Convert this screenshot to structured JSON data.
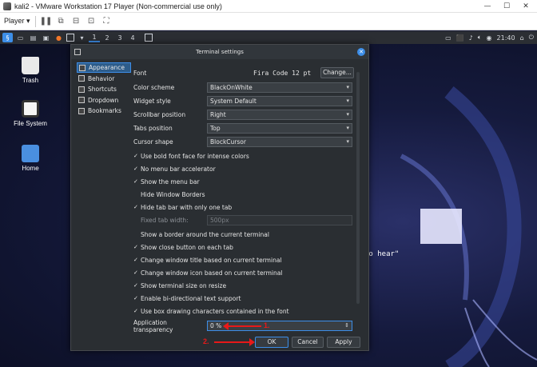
{
  "vmware": {
    "title": "kali2 - VMware Workstation 17 Player (Non-commercial use only)",
    "player_menu": "Player ▾"
  },
  "guest_panel": {
    "workspaces": [
      "1",
      "2",
      "3",
      "4"
    ],
    "clock": "21:40"
  },
  "desktop": {
    "icons": [
      {
        "label": "Trash"
      },
      {
        "label": "File System"
      },
      {
        "label": "Home"
      }
    ],
    "wallpaper_text": "to hear\""
  },
  "dialog": {
    "title": "Terminal settings",
    "sidebar": [
      {
        "label": "Appearance",
        "active": true
      },
      {
        "label": "Behavior"
      },
      {
        "label": "Shortcuts"
      },
      {
        "label": "Dropdown"
      },
      {
        "label": "Bookmarks"
      }
    ],
    "font": {
      "label": "Font",
      "value": "Fira Code 12 pt",
      "button": "Change..."
    },
    "combos": [
      {
        "label": "Color scheme",
        "value": "BlackOnWhite"
      },
      {
        "label": "Widget style",
        "value": "System Default"
      },
      {
        "label": "Scrollbar position",
        "value": "Right"
      },
      {
        "label": "Tabs position",
        "value": "Top"
      },
      {
        "label": "Cursor shape",
        "value": "BlockCursor"
      }
    ],
    "checks_a": [
      {
        "label": "Use bold font face for intense colors",
        "checked": true
      },
      {
        "label": "No menu bar accelerator",
        "checked": true
      },
      {
        "label": "Show the menu bar",
        "checked": true
      },
      {
        "label": "Hide Window Borders",
        "checked": false
      },
      {
        "label": "Hide tab bar with only one tab",
        "checked": true
      }
    ],
    "fixed_tab": {
      "label": "Fixed tab width:",
      "value": "500px"
    },
    "checks_b": [
      {
        "label": "Show a border around the current terminal",
        "checked": false
      },
      {
        "label": "Show close button on each tab",
        "checked": true
      },
      {
        "label": "Change window title based on current terminal",
        "checked": true
      },
      {
        "label": "Change window icon based on current terminal",
        "checked": true
      },
      {
        "label": "Show terminal size on resize",
        "checked": true
      },
      {
        "label": "Enable bi-directional text support",
        "checked": true
      },
      {
        "label": "Use box drawing characters contained in the font",
        "checked": true
      }
    ],
    "transparency": {
      "label": "Application transparency",
      "value": "0 %"
    },
    "buttons": {
      "ok": "OK",
      "cancel": "Cancel",
      "apply": "Apply"
    }
  },
  "annotations": {
    "step1": "1.",
    "step2": "2."
  },
  "colors": {
    "accent": "#3d8ee8",
    "annotation": "#e81919"
  }
}
